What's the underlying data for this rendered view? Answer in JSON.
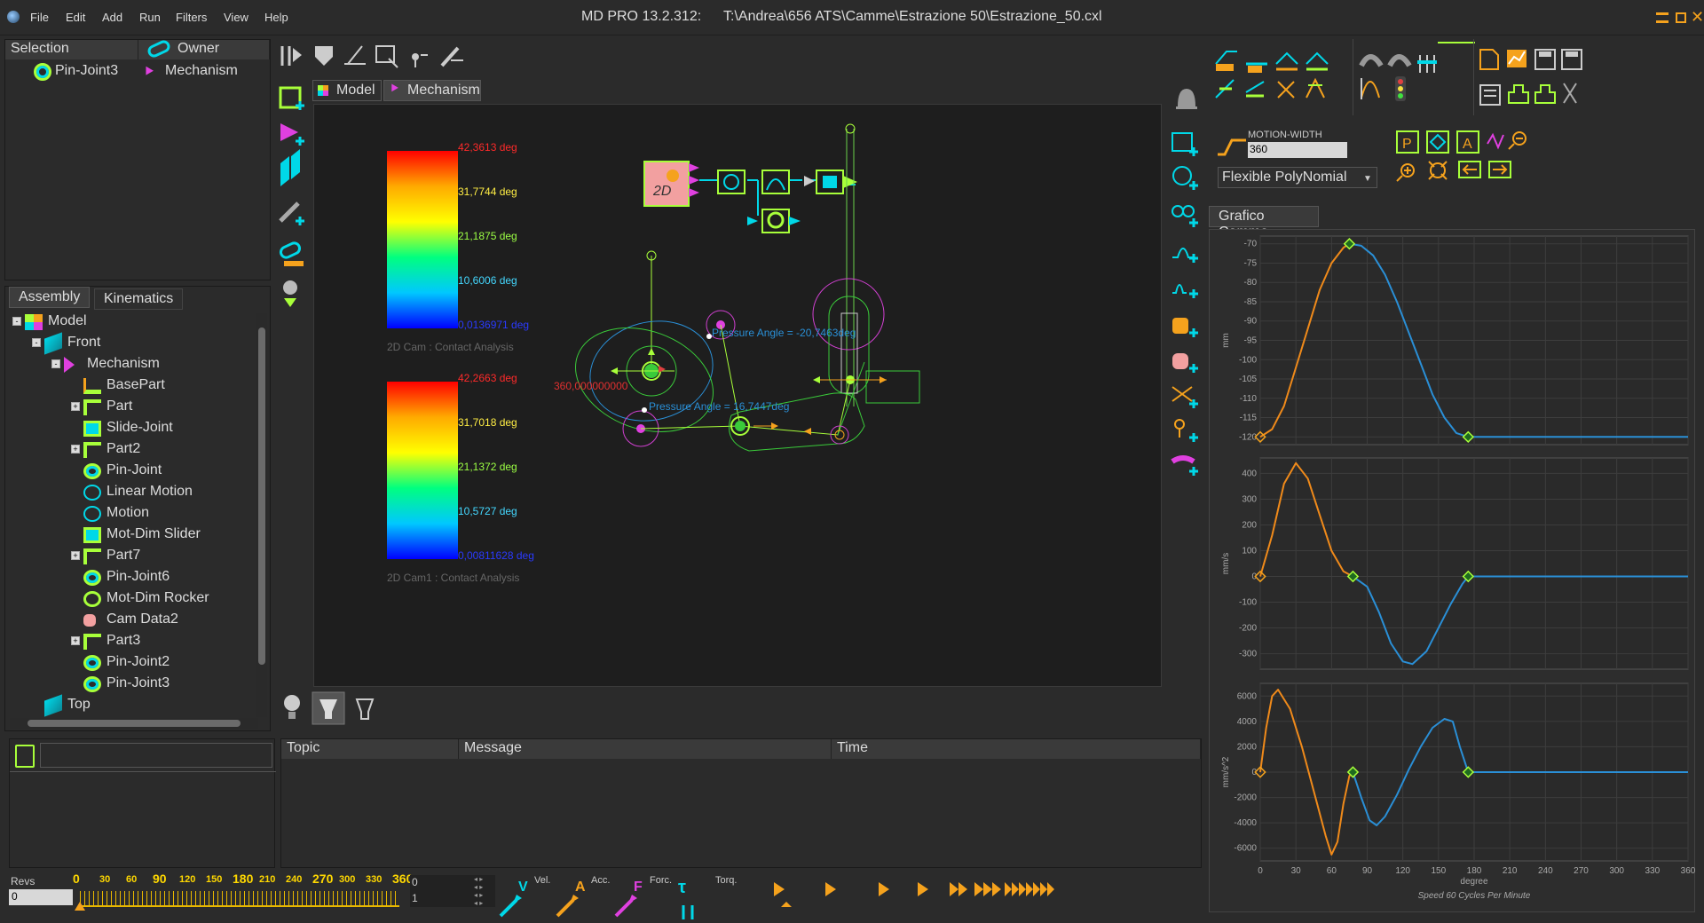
{
  "window": {
    "title": "MD PRO 13.2.312:",
    "path": "T:\\Andrea\\656 ATS\\Camme\\Estrazione 50\\Estrazione_50.cxl",
    "menu": [
      "File",
      "Edit",
      "Add",
      "Run",
      "Filters",
      "View",
      "Help"
    ]
  },
  "selection_panel": {
    "col_selection": "Selection",
    "col_owner": "Owner",
    "row_selection": "Pin-Joint3",
    "row_owner": "Mechanism"
  },
  "tree_tabs": [
    "Assembly",
    "Kinematics"
  ],
  "tree": [
    {
      "label": "Model",
      "indent": 0,
      "expand": "-",
      "icon": "model-icon"
    },
    {
      "label": "Front",
      "indent": 1,
      "expand": "-",
      "icon": "plane-icon"
    },
    {
      "label": "Mechanism",
      "indent": 2,
      "expand": "-",
      "icon": "mechanism-icon"
    },
    {
      "label": "BasePart",
      "indent": 3,
      "expand": "",
      "icon": "basepart-icon"
    },
    {
      "label": "Part",
      "indent": 3,
      "expand": "+",
      "icon": "part-icon"
    },
    {
      "label": "Slide-Joint",
      "indent": 3,
      "expand": "",
      "icon": "slide-joint-icon"
    },
    {
      "label": "Part2",
      "indent": 3,
      "expand": "+",
      "icon": "part-icon"
    },
    {
      "label": "Pin-Joint",
      "indent": 3,
      "expand": "",
      "icon": "pin-joint-icon"
    },
    {
      "label": "Linear Motion",
      "indent": 3,
      "expand": "",
      "icon": "motion-icon"
    },
    {
      "label": "Motion",
      "indent": 3,
      "expand": "",
      "icon": "motion-icon"
    },
    {
      "label": "Mot-Dim Slider",
      "indent": 3,
      "expand": "",
      "icon": "slider-icon"
    },
    {
      "label": "Part7",
      "indent": 3,
      "expand": "+",
      "icon": "part-icon"
    },
    {
      "label": "Pin-Joint6",
      "indent": 3,
      "expand": "",
      "icon": "pin-joint-icon"
    },
    {
      "label": "Mot-Dim Rocker",
      "indent": 3,
      "expand": "",
      "icon": "rocker-icon"
    },
    {
      "label": "Cam Data2",
      "indent": 3,
      "expand": "",
      "icon": "cam-data-icon"
    },
    {
      "label": "Part3",
      "indent": 3,
      "expand": "+",
      "icon": "part-icon"
    },
    {
      "label": "Pin-Joint2",
      "indent": 3,
      "expand": "",
      "icon": "pin-joint-icon"
    },
    {
      "label": "Pin-Joint3",
      "indent": 3,
      "expand": "",
      "icon": "pin-joint-icon"
    },
    {
      "label": "Top",
      "indent": 1,
      "expand": "",
      "icon": "plane-icon"
    }
  ],
  "view_tabs": [
    "Model",
    "Mechanism"
  ],
  "legend1": {
    "labels": [
      "42,3613 deg",
      "31,7744 deg",
      "21,1875 deg",
      "10,6006 deg",
      "0,0136971 deg"
    ],
    "caption": "2D Cam : Contact Analysis"
  },
  "legend2": {
    "labels": [
      "42,2663 deg",
      "31,7018 deg",
      "21,1372 deg",
      "10,5727 deg",
      "0,00811628 deg"
    ],
    "caption": "2D Cam1 : Contact Analysis"
  },
  "canvas_labels": {
    "pressure1": "Pressure Angle = -20,7463deg",
    "pressure2": "Pressure Angle = 16,7447deg",
    "angle": "360,000000000"
  },
  "motion": {
    "label": "MOTION-WIDTH",
    "value": "360",
    "type": "Flexible PolyNomial"
  },
  "graph_panel": {
    "title": "Grafico Camma",
    "speed": "Speed  60 Cycles Per Minute",
    "xlabel": "degree"
  },
  "chart_data": [
    {
      "type": "line",
      "ylabel": "mm",
      "ylim": [
        -122,
        -68
      ],
      "yticks": [
        -70,
        -75,
        -80,
        -85,
        -90,
        -95,
        -100,
        -105,
        -110,
        -115,
        -120
      ],
      "xlim": [
        0,
        360
      ],
      "series": [
        {
          "color": "#f08a1a",
          "x": [
            0,
            10,
            20,
            30,
            40,
            50,
            60,
            70,
            75
          ],
          "y": [
            -120,
            -118,
            -112,
            -102,
            -92,
            -82,
            -75,
            -71,
            -70
          ]
        },
        {
          "color": "#2a8fd6",
          "x": [
            75,
            85,
            95,
            105,
            115,
            125,
            135,
            145,
            155,
            165,
            175,
            360
          ],
          "y": [
            -70,
            -70.5,
            -73,
            -78,
            -85,
            -93,
            -101,
            -109,
            -115,
            -119,
            -120,
            -120
          ]
        }
      ]
    },
    {
      "type": "line",
      "ylabel": "mm/s",
      "ylim": [
        -360,
        460
      ],
      "yticks": [
        400,
        300,
        200,
        100,
        0,
        -100,
        -200,
        -300
      ],
      "xlim": [
        0,
        360
      ],
      "series": [
        {
          "color": "#f08a1a",
          "x": [
            0,
            10,
            20,
            30,
            40,
            50,
            60,
            70,
            78
          ],
          "y": [
            0,
            160,
            360,
            440,
            380,
            240,
            100,
            20,
            0
          ]
        },
        {
          "color": "#2a8fd6",
          "x": [
            78,
            90,
            100,
            110,
            120,
            128,
            140,
            150,
            160,
            170,
            175,
            360
          ],
          "y": [
            0,
            -40,
            -140,
            -260,
            -330,
            -340,
            -290,
            -200,
            -110,
            -30,
            0,
            0
          ]
        }
      ]
    },
    {
      "type": "line",
      "ylabel": "mm/s^2",
      "ylim": [
        -7000,
        7000
      ],
      "yticks": [
        6000,
        4000,
        2000,
        0,
        -2000,
        -4000,
        -6000
      ],
      "xlim": [
        0,
        360
      ],
      "series": [
        {
          "color": "#f08a1a",
          "x": [
            0,
            5,
            10,
            15,
            25,
            35,
            45,
            55,
            60,
            65,
            70,
            75,
            78
          ],
          "y": [
            0,
            3500,
            6000,
            6500,
            5000,
            2000,
            -1500,
            -5000,
            -6500,
            -5500,
            -2500,
            -300,
            0
          ]
        },
        {
          "color": "#2a8fd6",
          "x": [
            78,
            85,
            92,
            98,
            105,
            115,
            125,
            135,
            145,
            155,
            162,
            168,
            175,
            360
          ],
          "y": [
            0,
            -2000,
            -3800,
            -4200,
            -3500,
            -1800,
            200,
            2000,
            3500,
            4200,
            4000,
            2000,
            0,
            0
          ]
        }
      ],
      "xticks": [
        0,
        30,
        60,
        90,
        120,
        150,
        180,
        210,
        240,
        270,
        300,
        330,
        360
      ]
    }
  ],
  "log_panel": {
    "col_topic": "Topic",
    "col_message": "Message",
    "col_time": "Time"
  },
  "revs": {
    "label": "Revs",
    "value": "0",
    "ticks": [
      "0",
      "30",
      "60",
      "90",
      "120",
      "150",
      "180",
      "210",
      "240",
      "270",
      "300",
      "330",
      "360"
    ],
    "spin1": "0",
    "spin2": "1",
    "buttons": [
      "Vel.",
      "Acc.",
      "Forc.",
      "Torq."
    ]
  },
  "colors": {
    "accent_green": "#a8ff3a",
    "accent_orange": "#f5a21d",
    "cyan": "#00d8e8",
    "magenta": "#e040e0",
    "series_orange": "#f08a1a",
    "series_blue": "#2a8fd6"
  }
}
